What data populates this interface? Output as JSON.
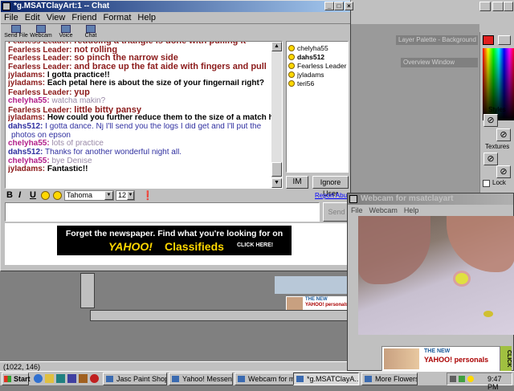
{
  "chat_window": {
    "title": "*g.MSATClayArt:1 -- Chat",
    "menu": [
      "File",
      "Edit",
      "View",
      "Friend",
      "Format",
      "Help"
    ],
    "toolbar": [
      {
        "label": "Send File",
        "icon": "send-file-icon"
      },
      {
        "label": "Webcam",
        "icon": "webcam-icon"
      },
      {
        "label": "Voice",
        "icon": "voice-icon"
      },
      {
        "label": "Chat",
        "icon": "chat-icon"
      }
    ],
    "messages": [
      {
        "user": "Fearless Leader:",
        "text": "reducing a triangle is done with pulling it",
        "uc": "fl",
        "tc": "fm"
      },
      {
        "user": "Fearless Leader:",
        "text": "not rolling",
        "uc": "fl",
        "tc": "fm"
      },
      {
        "user": "Fearless Leader:",
        "text": "so pinch the narrow side",
        "uc": "fl",
        "tc": "fm"
      },
      {
        "user": "Fearless Leader:",
        "text": "and brace up the fat aide with fingers and pull",
        "uc": "fl",
        "tc": "fm"
      },
      {
        "user": "jyladams:",
        "text": "I gotta practice!!",
        "uc": "jy",
        "tc": "jm"
      },
      {
        "user": "jyladams:",
        "text": "Each petal here is about the size of your fingernail right?",
        "uc": "jy",
        "tc": "jm"
      },
      {
        "user": "Fearless Leader:",
        "text": "yup",
        "uc": "fl",
        "tc": "fm"
      },
      {
        "user": "chelyha55:",
        "text": "watcha makin?",
        "uc": "ch",
        "tc": "cm"
      },
      {
        "user": "Fearless Leader:",
        "text": "little bitty pansy",
        "uc": "fl",
        "tc": "fm"
      },
      {
        "user": "jyladams:",
        "text": "How could you further reduce them to the size of a match head?",
        "uc": "jy",
        "tc": "jm"
      },
      {
        "user": "dahs512:",
        "text": "I gotta dance. Nj I'll send you the logs I did get and I'll put the",
        "uc": "dh",
        "tc": "dm"
      },
      {
        "user": "",
        "text": "photos on epson",
        "uc": "dh",
        "tc": "dm"
      },
      {
        "user": "chelyha55:",
        "text": "lots of practice",
        "uc": "ch",
        "tc": "cm"
      },
      {
        "user": "dahs512:",
        "text": "Thanks for another wonderful night all.",
        "uc": "dh",
        "tc": "dm"
      },
      {
        "user": "chelyha55:",
        "text": "bye Denise",
        "uc": "ch",
        "tc": "cm"
      },
      {
        "user": "jyladams:",
        "text": "Fantastic!!",
        "uc": "jy",
        "tc": "jm"
      }
    ],
    "users": [
      {
        "name": "chelyha55",
        "bold": false
      },
      {
        "name": "dahs512",
        "bold": true
      },
      {
        "name": "Fearless Leader",
        "bold": false
      },
      {
        "name": "jyladams",
        "bold": false
      },
      {
        "name": "teri56",
        "bold": false
      }
    ],
    "im_label": "IM",
    "ignore_label": "Ignore User",
    "format": {
      "bold": "B",
      "italic": "I",
      "underline": "U",
      "font": "Tahoma",
      "size": "12"
    },
    "report_abuse": "Report Abuse",
    "send_label": "Send",
    "ad": {
      "tagline": "Forget the newspaper. Find what you're looking for on",
      "brand": "YAHOO!",
      "section": "Classifieds",
      "cta": "CLICK HERE!"
    }
  },
  "webcam_window": {
    "title": "Webcam for msatclayart",
    "menu": [
      "File",
      "Webcam",
      "Help"
    ],
    "ad": {
      "line1": "THE NEW",
      "brand": "YAHOO! personals",
      "cta": "CLICK"
    }
  },
  "psp": {
    "layer_palette": "Layer Palette - Background",
    "overview": "Overview Window",
    "styles": "Styles",
    "textures": "Textures",
    "lock": "Lock"
  },
  "behind_ad": {
    "line1": "THE NEW",
    "brand": "YAHOO! personals"
  },
  "status_coords": "(1022, 146)",
  "taskbar": {
    "start": "Start",
    "tasks": [
      {
        "label": "Jasc Paint Shop P...",
        "active": false
      },
      {
        "label": "Yahoo! Messenger",
        "active": false
      },
      {
        "label": "Webcam for msat...",
        "active": false
      },
      {
        "label": "*g.MSATClayA...",
        "active": true
      },
      {
        "label": "More Flowers De...",
        "active": false
      }
    ],
    "time": "9:47 PM"
  },
  "colors": {
    "title_active": "#0a246a",
    "title_inactive": "#808080",
    "desktop": "#808080",
    "chrome": "#c0c0c0"
  }
}
